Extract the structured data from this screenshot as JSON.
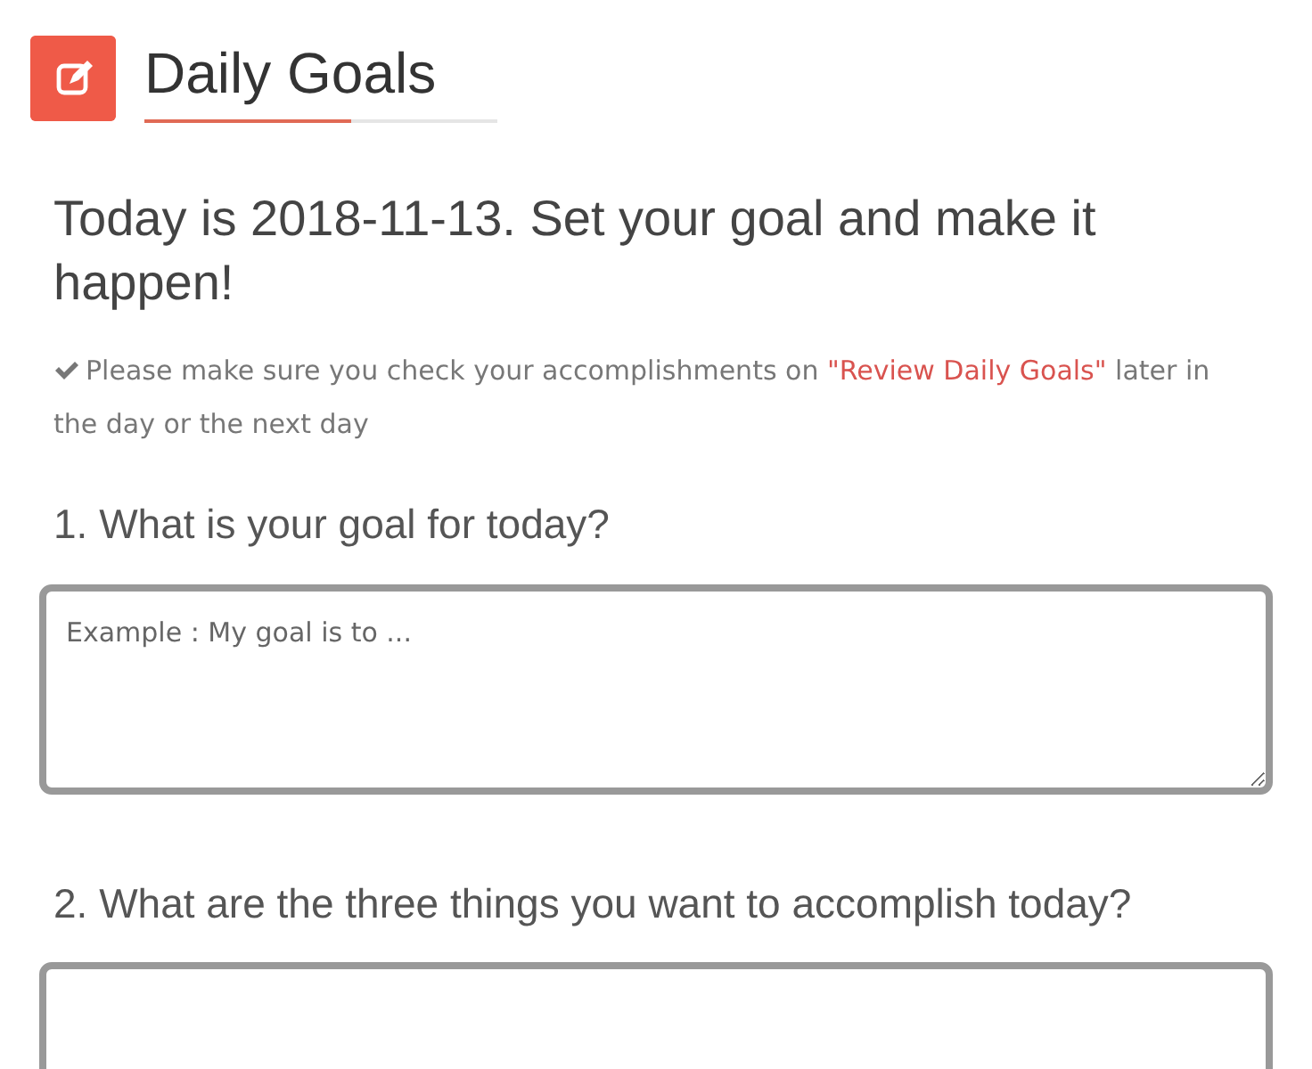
{
  "header": {
    "title": "Daily Goals"
  },
  "heading": "Today is 2018-11-13. Set your goal and make it happen!",
  "note": {
    "before": "Please make sure you check your accomplishments on ",
    "link": "\"Review Daily Goals\"",
    "after": " later in the day or the next day"
  },
  "questions": [
    {
      "label": "1. What is your goal for today?",
      "placeholder": "Example : My goal is to ..."
    },
    {
      "label": "2. What are the three things you want to accomplish today?"
    }
  ]
}
